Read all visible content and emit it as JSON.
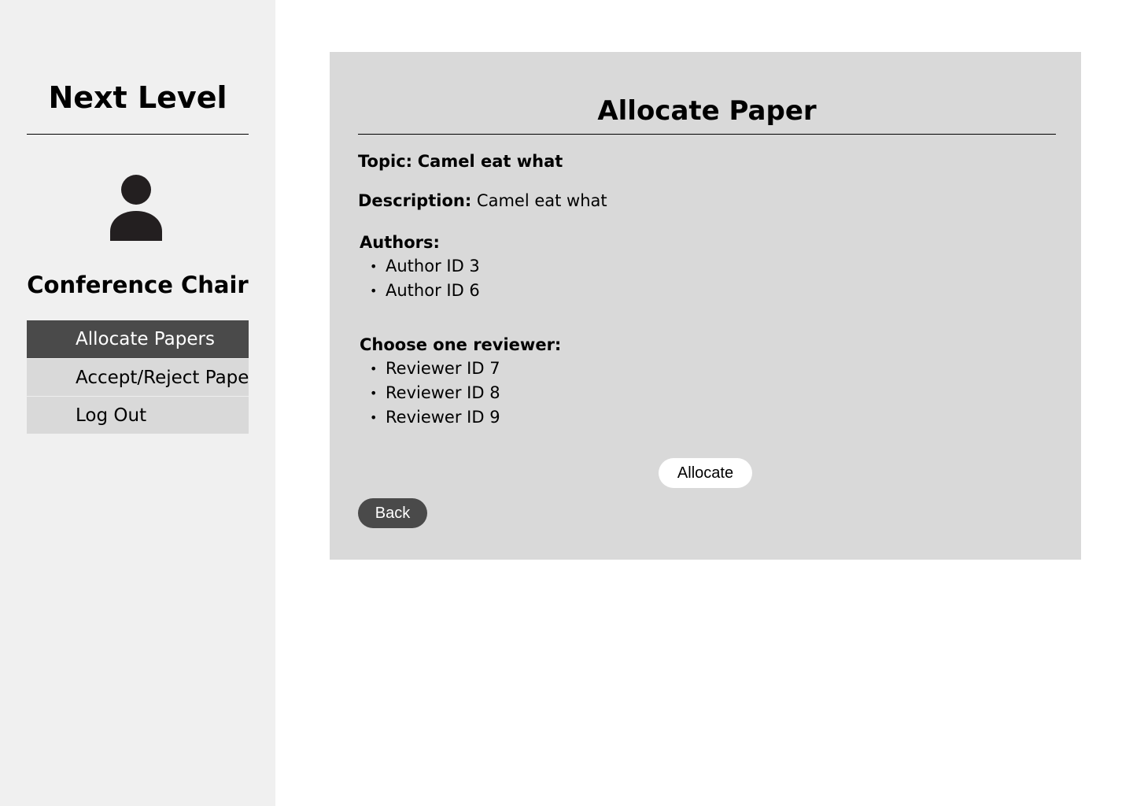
{
  "sidebar": {
    "brand": "Next Level",
    "avatar_icon": "user-icon",
    "role": "Conference Chair",
    "nav": [
      {
        "label": "Allocate Papers",
        "active": true
      },
      {
        "label": "Accept/Reject Paper",
        "active": false
      },
      {
        "label": "Log Out",
        "active": false
      }
    ]
  },
  "main": {
    "title": "Allocate Paper",
    "topic_label": "Topic:",
    "topic_value": "Camel eat what",
    "description_label": "Description:",
    "description_value": "Camel eat what",
    "authors_label": "Authors:",
    "authors": [
      "Author ID 3",
      "Author ID 6"
    ],
    "reviewers_label": "Choose one reviewer:",
    "reviewers": [
      "Reviewer ID 7",
      "Reviewer ID 8",
      "Reviewer ID 9"
    ],
    "allocate_label": "Allocate",
    "back_label": "Back"
  },
  "colors": {
    "sidebar_bg": "#f0f0f0",
    "panel_bg": "#d9d9d9",
    "active_nav_bg": "#4a4a4a",
    "back_button_bg": "#4a4a4a",
    "allocate_button_bg": "#ffffff"
  }
}
